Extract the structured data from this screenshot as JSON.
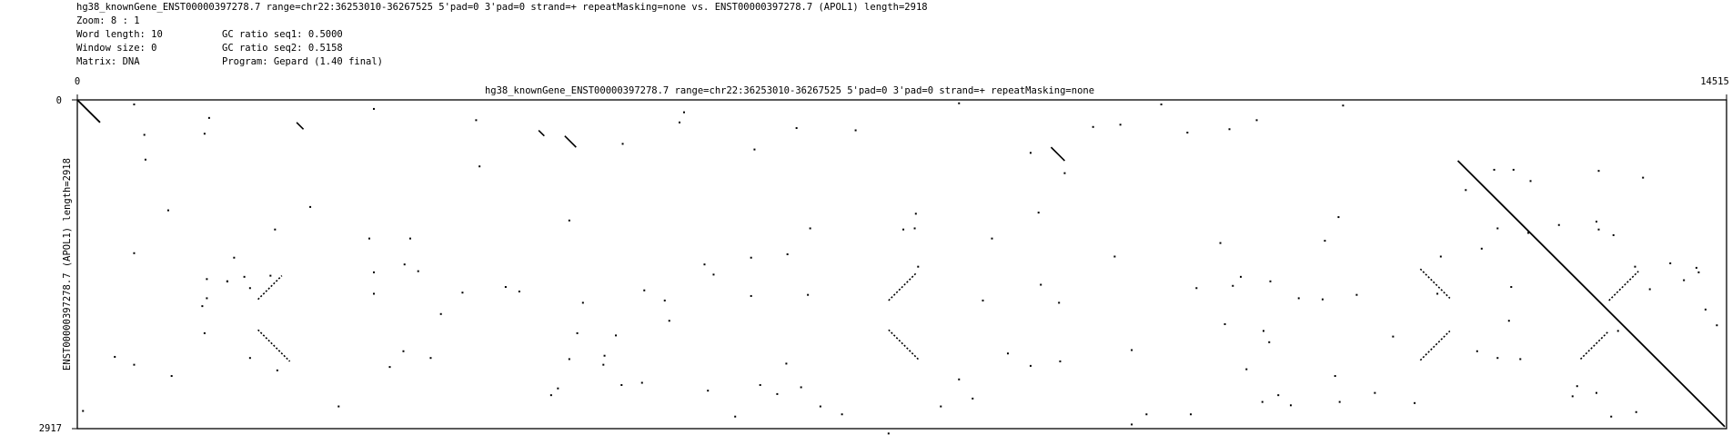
{
  "header": {
    "line1": "hg38_knownGene_ENST00000397278.7 range=chr22:36253010-36267525 5'pad=0 3'pad=0 strand=+ repeatMasking=none vs. ENST00000397278.7 (APOL1) length=2918",
    "zoom": "Zoom: 8 : 1",
    "word_length": "Word length: 10",
    "window_size": "Window size: 0",
    "matrix": "Matrix: DNA",
    "gc1": "GC ratio seq1: 0.5000",
    "gc2": "GC ratio seq2: 0.5158",
    "program": "Program: Gepard (1.40 final)"
  },
  "chart_data": {
    "type": "scatter",
    "subtype": "dotplot",
    "title": "hg38_knownGene_ENST00000397278.7 range=chr22:36253010-36267525 5'pad=0 3'pad=0 strand=+ repeatMasking=none",
    "ylabel": "ENST00000397278.7 (APOL1) length=2918",
    "xlim": [
      0,
      14515
    ],
    "ylim": [
      0,
      2917
    ],
    "x_ticks": [
      "0",
      "14515"
    ],
    "y_ticks": [
      "0",
      "2917"
    ],
    "y_inverted": true,
    "grid": false,
    "segments": [
      {
        "x1": 0,
        "y1": 0,
        "x2": 200,
        "y2": 200
      },
      {
        "x1": 12150,
        "y1": 540,
        "x2": 14500,
        "y2": 2900
      },
      {
        "x1": 1930,
        "y1": 200,
        "x2": 1990,
        "y2": 260
      },
      {
        "x1": 4060,
        "y1": 270,
        "x2": 4110,
        "y2": 320
      },
      {
        "x1": 4290,
        "y1": 320,
        "x2": 4390,
        "y2": 420
      },
      {
        "x1": 8570,
        "y1": 420,
        "x2": 8690,
        "y2": 540
      },
      {
        "x1": 1590,
        "y1": 1770,
        "x2": 1800,
        "y2": 1560
      },
      {
        "x1": 1590,
        "y1": 2040,
        "x2": 1870,
        "y2": 2320
      },
      {
        "x1": 7140,
        "y1": 1780,
        "x2": 7380,
        "y2": 1540
      },
      {
        "x1": 7140,
        "y1": 2040,
        "x2": 7410,
        "y2": 2310
      },
      {
        "x1": 11820,
        "y1": 1500,
        "x2": 12080,
        "y2": 1760
      },
      {
        "x1": 11820,
        "y1": 2310,
        "x2": 12080,
        "y2": 2050
      },
      {
        "x1": 13230,
        "y1": 2300,
        "x2": 13480,
        "y2": 2050
      },
      {
        "x1": 13480,
        "y1": 1780,
        "x2": 13740,
        "y2": 1520
      }
    ],
    "points": [
      [
        500,
        40
      ],
      [
        1160,
        160
      ],
      [
        590,
        310
      ],
      [
        1120,
        300
      ],
      [
        600,
        530
      ],
      [
        3510,
        180
      ],
      [
        2610,
        80
      ],
      [
        5340,
        110
      ],
      [
        5300,
        200
      ],
      [
        7760,
        30
      ],
      [
        4800,
        390
      ],
      [
        3540,
        590
      ],
      [
        5960,
        440
      ],
      [
        6330,
        250
      ],
      [
        6850,
        270
      ],
      [
        8690,
        650
      ],
      [
        8390,
        470
      ],
      [
        9180,
        220
      ],
      [
        8940,
        240
      ],
      [
        9540,
        40
      ],
      [
        9770,
        290
      ],
      [
        10140,
        260
      ],
      [
        10380,
        180
      ],
      [
        11140,
        50
      ],
      [
        12640,
        620
      ],
      [
        12470,
        620
      ],
      [
        13390,
        630
      ],
      [
        12220,
        800
      ],
      [
        12790,
        720
      ],
      [
        13780,
        690
      ],
      [
        13370,
        1080
      ],
      [
        12500,
        1140
      ],
      [
        12770,
        1180
      ],
      [
        13040,
        1110
      ],
      [
        13390,
        1150
      ],
      [
        13520,
        1200
      ],
      [
        14020,
        1450
      ],
      [
        14250,
        1490
      ],
      [
        14270,
        1530
      ],
      [
        14140,
        1600
      ],
      [
        13710,
        1480
      ],
      [
        13840,
        1680
      ],
      [
        14330,
        1860
      ],
      [
        14430,
        2000
      ],
      [
        13560,
        2050
      ],
      [
        12320,
        2230
      ],
      [
        12620,
        1660
      ],
      [
        12600,
        1960
      ],
      [
        11970,
        1720
      ],
      [
        11580,
        2100
      ],
      [
        11260,
        1730
      ],
      [
        10750,
        1760
      ],
      [
        10440,
        2050
      ],
      [
        10290,
        2390
      ],
      [
        10570,
        2620
      ],
      [
        9800,
        2790
      ],
      [
        8190,
        2250
      ],
      [
        8390,
        2360
      ],
      [
        8480,
        1640
      ],
      [
        7970,
        1780
      ],
      [
        7370,
        1140
      ],
      [
        7270,
        1150
      ],
      [
        7400,
        1480
      ],
      [
        6250,
        1370
      ],
      [
        5600,
        1550
      ],
      [
        5930,
        1740
      ],
      [
        5170,
        1780
      ],
      [
        5210,
        1960
      ],
      [
        4450,
        1800
      ],
      [
        4400,
        2070
      ],
      [
        4740,
        2090
      ],
      [
        4330,
        2300
      ],
      [
        4630,
        2350
      ],
      [
        4170,
        2620
      ],
      [
        4230,
        2560
      ],
      [
        4970,
        2510
      ],
      [
        4790,
        2530
      ],
      [
        4330,
        1070
      ],
      [
        5520,
        1460
      ],
      [
        5930,
        1400
      ],
      [
        4990,
        1690
      ],
      [
        3890,
        1700
      ],
      [
        3390,
        1710
      ],
      [
        3000,
        1520
      ],
      [
        2880,
        1460
      ],
      [
        2930,
        1230
      ],
      [
        2610,
        1530
      ],
      [
        2570,
        1230
      ],
      [
        1700,
        1560
      ],
      [
        1520,
        1670
      ],
      [
        1320,
        1610
      ],
      [
        1140,
        1590
      ],
      [
        1140,
        1760
      ],
      [
        1100,
        1830
      ],
      [
        1120,
        2070
      ],
      [
        1520,
        2290
      ],
      [
        500,
        1360
      ],
      [
        800,
        980
      ],
      [
        1320,
        1610
      ],
      [
        1470,
        1570
      ],
      [
        1380,
        1400
      ],
      [
        1740,
        1150
      ],
      [
        2050,
        950
      ],
      [
        330,
        2280
      ],
      [
        500,
        2350
      ],
      [
        830,
        2450
      ],
      [
        2300,
        2720
      ],
      [
        2750,
        2370
      ],
      [
        3200,
        1900
      ],
      [
        3770,
        1660
      ],
      [
        2610,
        1720
      ],
      [
        2870,
        2230
      ],
      [
        1760,
        2400
      ],
      [
        6370,
        2550
      ],
      [
        6010,
        2530
      ],
      [
        5550,
        2580
      ],
      [
        6160,
        2610
      ],
      [
        6540,
        2720
      ],
      [
        6730,
        2790
      ],
      [
        7140,
        2960
      ],
      [
        7600,
        2720
      ],
      [
        8650,
        2320
      ],
      [
        9280,
        2220
      ],
      [
        9410,
        2790
      ],
      [
        9280,
        2880
      ],
      [
        9850,
        1670
      ],
      [
        10170,
        1650
      ],
      [
        10500,
        1610
      ],
      [
        10100,
        1990
      ],
      [
        10960,
        1770
      ],
      [
        10490,
        2150
      ],
      [
        11070,
        2450
      ],
      [
        11420,
        2600
      ],
      [
        11770,
        2690
      ],
      [
        12500,
        2290
      ],
      [
        12700,
        2300
      ],
      [
        13370,
        2600
      ],
      [
        13200,
        2540
      ],
      [
        13160,
        2630
      ],
      [
        13720,
        2770
      ],
      [
        13500,
        2810
      ],
      [
        10430,
        2680
      ],
      [
        10680,
        2710
      ],
      [
        11110,
        2680
      ],
      [
        7880,
        2650
      ],
      [
        8050,
        1230
      ],
      [
        7380,
        1010
      ],
      [
        6450,
        1140
      ],
      [
        6430,
        1730
      ],
      [
        9130,
        1390
      ],
      [
        10240,
        1570
      ],
      [
        10060,
        1270
      ],
      [
        11100,
        1040
      ],
      [
        10980,
        1250
      ],
      [
        12000,
        1390
      ],
      [
        12360,
        1320
      ],
      [
        5790,
        2810
      ],
      [
        6240,
        2340
      ],
      [
        7760,
        2480
      ],
      [
        8460,
        1000
      ],
      [
        8640,
        1800
      ],
      [
        3110,
        2290
      ],
      [
        4640,
        2270
      ],
      [
        50,
        2760
      ]
    ]
  }
}
